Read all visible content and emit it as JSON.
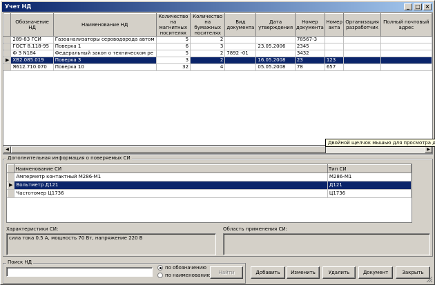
{
  "window": {
    "title": "Учет НД"
  },
  "nd_table": {
    "columns": [
      "Обозначение НД",
      "Наименование НД",
      "Количество на\nмагнитных\nносителях",
      "Количество на\nбумажных\nносителях",
      "Вид\nдокумента",
      "Дата\nутверждения",
      "Номер\nдокумента",
      "Номер\nакта",
      "Организация\nразработчик",
      "Полный почтовый адрес"
    ],
    "rows": [
      [
        "289-83 ГСИ",
        "Газоанализаторы сероводорода автом",
        "5",
        "2",
        "",
        "",
        "78567-3",
        "",
        "",
        ""
      ],
      [
        "ГОСТ 8.118-95",
        "Поверка 1",
        "6",
        "3",
        "",
        "23.05.2006",
        "2345",
        "",
        "",
        ""
      ],
      [
        "Ф З N184",
        "Федеральный закон о техническом ре",
        "5",
        "2",
        "7892 -01",
        "",
        "3432",
        "",
        "",
        ""
      ],
      [
        "ХВ2.085.019",
        "Поверка 3",
        "3",
        "2",
        "",
        "16.05.2008",
        "23",
        "123",
        "",
        ""
      ],
      [
        "Я612.710.070",
        "Поверка 10",
        "32",
        "4",
        "",
        "05.05.2008",
        "78",
        "657",
        "",
        ""
      ]
    ],
    "selected_row": 3
  },
  "tooltip": "Двойной щелчок мышью для просмотра документа",
  "si_group": {
    "label": "Дополнительная информация о поверяемых СИ",
    "columns": [
      "Наименование СИ",
      "Тип СИ"
    ],
    "rows": [
      [
        "Амперметр контактный М286-М1",
        "М286-М1"
      ],
      [
        "Вольтметр Д121",
        "Д121"
      ],
      [
        "Частотомер Ц1736",
        "Ц1736"
      ]
    ],
    "selected_row": 1
  },
  "characteristics": {
    "label": "Характеристики СИ:",
    "value": "сила тока 0.5 А, мощность 70 Вт, напряжение  220 В"
  },
  "application": {
    "label": "Область применения СИ:",
    "value": ""
  },
  "search": {
    "label": "Поиск НД",
    "value": "",
    "radio_by_code": "по обозначению",
    "radio_by_name": "по наименованию",
    "find_button": "Найти"
  },
  "buttons": {
    "add": "Добавить",
    "edit": "Изменить",
    "delete": "Удалить",
    "document": "Документ",
    "close": "Закрыть"
  },
  "colors": {
    "title_start": "#0a246a",
    "title_end": "#a6caf0",
    "selection": "#0a246a",
    "tooltip_bg": "#ffffe1"
  }
}
